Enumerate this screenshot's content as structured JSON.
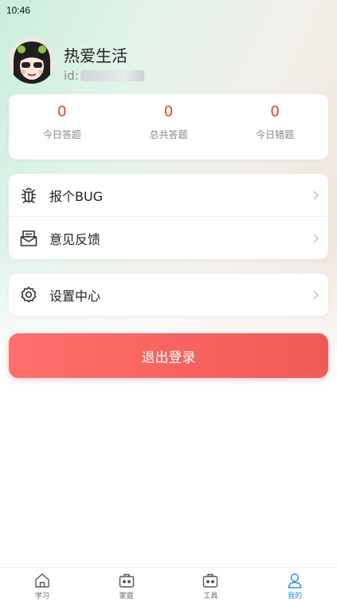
{
  "status_bar": {
    "time": "10:46"
  },
  "profile": {
    "name": "热爱生活",
    "id_prefix": "id:"
  },
  "stats": [
    {
      "value": "0",
      "label": "今日答题"
    },
    {
      "value": "0",
      "label": "总共答题"
    },
    {
      "value": "0",
      "label": "今日错题"
    }
  ],
  "menu": {
    "report_bug": "报个BUG",
    "feedback": "意见反馈",
    "settings": "设置中心"
  },
  "logout_label": "退出登录",
  "tabs": [
    {
      "label": "学习",
      "icon": "home-icon"
    },
    {
      "label": "家庭",
      "icon": "toolbox-icon"
    },
    {
      "label": "工具",
      "icon": "toolbox-icon"
    },
    {
      "label": "我的",
      "icon": "user-icon"
    }
  ],
  "colors": {
    "accent": "#2b8be6",
    "stat_value": "#d4401f",
    "logout": "#f05a55"
  }
}
